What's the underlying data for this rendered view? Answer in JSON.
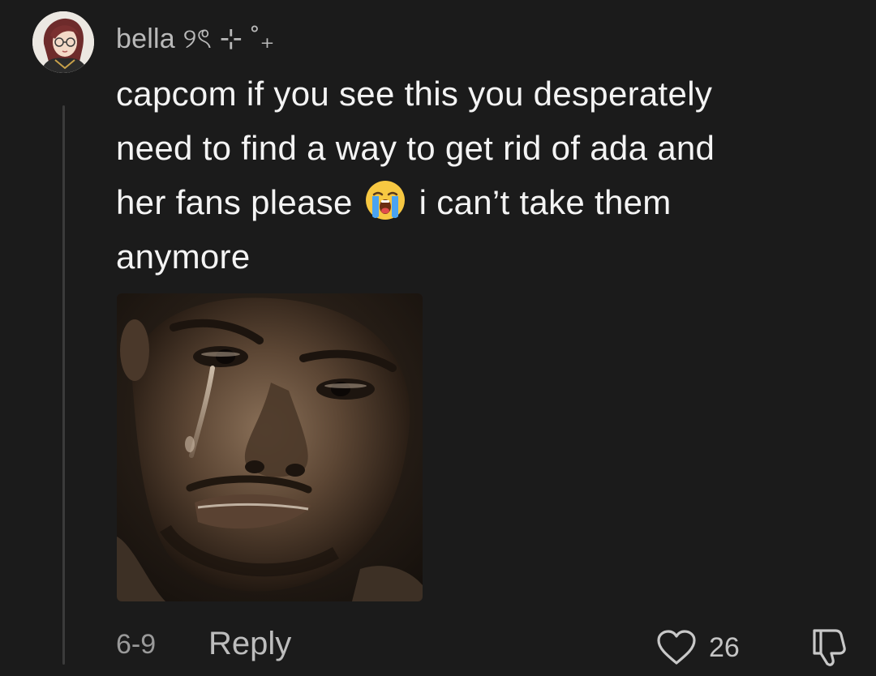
{
  "comment": {
    "username": "bella ୨ৎ ⊹ ˚₊",
    "text_line1": "capcom if you see this you desperately",
    "text_line2": "need to find a way to get rid of ada and",
    "text_line3_before_emoji": "her fans please",
    "text_line3_after_emoji": "i can’t take them",
    "text_line4": "anymore",
    "emoji": "loudly-crying-face",
    "date": "6-9",
    "reply_label": "Reply",
    "like_count": "26"
  },
  "icons": {
    "like": "heart-outline-icon",
    "dislike": "thumbs-down-outline-icon"
  },
  "colors": {
    "background": "#1b1b1b",
    "text": "#f4f4f4",
    "muted": "#9a9a9a"
  }
}
